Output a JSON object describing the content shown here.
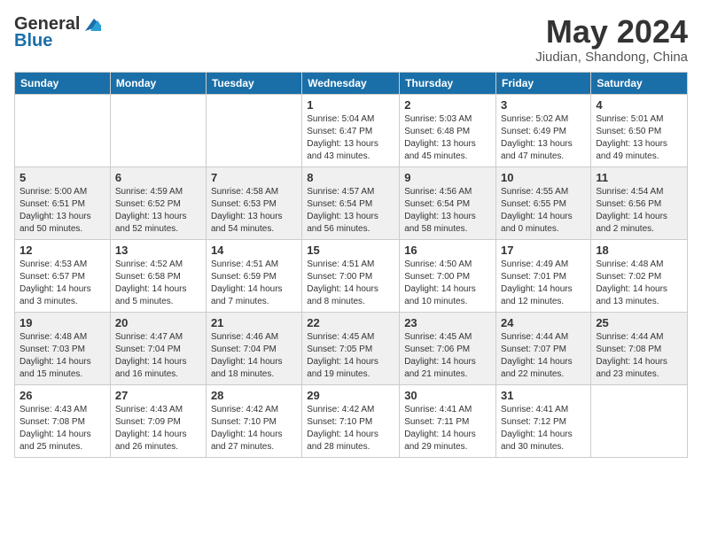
{
  "logo": {
    "general": "General",
    "blue": "Blue"
  },
  "title": "May 2024",
  "location": "Jiudian, Shandong, China",
  "weekdays": [
    "Sunday",
    "Monday",
    "Tuesday",
    "Wednesday",
    "Thursday",
    "Friday",
    "Saturday"
  ],
  "weeks": [
    [
      {
        "day": "",
        "info": ""
      },
      {
        "day": "",
        "info": ""
      },
      {
        "day": "",
        "info": ""
      },
      {
        "day": "1",
        "info": "Sunrise: 5:04 AM\nSunset: 6:47 PM\nDaylight: 13 hours\nand 43 minutes."
      },
      {
        "day": "2",
        "info": "Sunrise: 5:03 AM\nSunset: 6:48 PM\nDaylight: 13 hours\nand 45 minutes."
      },
      {
        "day": "3",
        "info": "Sunrise: 5:02 AM\nSunset: 6:49 PM\nDaylight: 13 hours\nand 47 minutes."
      },
      {
        "day": "4",
        "info": "Sunrise: 5:01 AM\nSunset: 6:50 PM\nDaylight: 13 hours\nand 49 minutes."
      }
    ],
    [
      {
        "day": "5",
        "info": "Sunrise: 5:00 AM\nSunset: 6:51 PM\nDaylight: 13 hours\nand 50 minutes."
      },
      {
        "day": "6",
        "info": "Sunrise: 4:59 AM\nSunset: 6:52 PM\nDaylight: 13 hours\nand 52 minutes."
      },
      {
        "day": "7",
        "info": "Sunrise: 4:58 AM\nSunset: 6:53 PM\nDaylight: 13 hours\nand 54 minutes."
      },
      {
        "day": "8",
        "info": "Sunrise: 4:57 AM\nSunset: 6:54 PM\nDaylight: 13 hours\nand 56 minutes."
      },
      {
        "day": "9",
        "info": "Sunrise: 4:56 AM\nSunset: 6:54 PM\nDaylight: 13 hours\nand 58 minutes."
      },
      {
        "day": "10",
        "info": "Sunrise: 4:55 AM\nSunset: 6:55 PM\nDaylight: 14 hours\nand 0 minutes."
      },
      {
        "day": "11",
        "info": "Sunrise: 4:54 AM\nSunset: 6:56 PM\nDaylight: 14 hours\nand 2 minutes."
      }
    ],
    [
      {
        "day": "12",
        "info": "Sunrise: 4:53 AM\nSunset: 6:57 PM\nDaylight: 14 hours\nand 3 minutes."
      },
      {
        "day": "13",
        "info": "Sunrise: 4:52 AM\nSunset: 6:58 PM\nDaylight: 14 hours\nand 5 minutes."
      },
      {
        "day": "14",
        "info": "Sunrise: 4:51 AM\nSunset: 6:59 PM\nDaylight: 14 hours\nand 7 minutes."
      },
      {
        "day": "15",
        "info": "Sunrise: 4:51 AM\nSunset: 7:00 PM\nDaylight: 14 hours\nand 8 minutes."
      },
      {
        "day": "16",
        "info": "Sunrise: 4:50 AM\nSunset: 7:00 PM\nDaylight: 14 hours\nand 10 minutes."
      },
      {
        "day": "17",
        "info": "Sunrise: 4:49 AM\nSunset: 7:01 PM\nDaylight: 14 hours\nand 12 minutes."
      },
      {
        "day": "18",
        "info": "Sunrise: 4:48 AM\nSunset: 7:02 PM\nDaylight: 14 hours\nand 13 minutes."
      }
    ],
    [
      {
        "day": "19",
        "info": "Sunrise: 4:48 AM\nSunset: 7:03 PM\nDaylight: 14 hours\nand 15 minutes."
      },
      {
        "day": "20",
        "info": "Sunrise: 4:47 AM\nSunset: 7:04 PM\nDaylight: 14 hours\nand 16 minutes."
      },
      {
        "day": "21",
        "info": "Sunrise: 4:46 AM\nSunset: 7:04 PM\nDaylight: 14 hours\nand 18 minutes."
      },
      {
        "day": "22",
        "info": "Sunrise: 4:45 AM\nSunset: 7:05 PM\nDaylight: 14 hours\nand 19 minutes."
      },
      {
        "day": "23",
        "info": "Sunrise: 4:45 AM\nSunset: 7:06 PM\nDaylight: 14 hours\nand 21 minutes."
      },
      {
        "day": "24",
        "info": "Sunrise: 4:44 AM\nSunset: 7:07 PM\nDaylight: 14 hours\nand 22 minutes."
      },
      {
        "day": "25",
        "info": "Sunrise: 4:44 AM\nSunset: 7:08 PM\nDaylight: 14 hours\nand 23 minutes."
      }
    ],
    [
      {
        "day": "26",
        "info": "Sunrise: 4:43 AM\nSunset: 7:08 PM\nDaylight: 14 hours\nand 25 minutes."
      },
      {
        "day": "27",
        "info": "Sunrise: 4:43 AM\nSunset: 7:09 PM\nDaylight: 14 hours\nand 26 minutes."
      },
      {
        "day": "28",
        "info": "Sunrise: 4:42 AM\nSunset: 7:10 PM\nDaylight: 14 hours\nand 27 minutes."
      },
      {
        "day": "29",
        "info": "Sunrise: 4:42 AM\nSunset: 7:10 PM\nDaylight: 14 hours\nand 28 minutes."
      },
      {
        "day": "30",
        "info": "Sunrise: 4:41 AM\nSunset: 7:11 PM\nDaylight: 14 hours\nand 29 minutes."
      },
      {
        "day": "31",
        "info": "Sunrise: 4:41 AM\nSunset: 7:12 PM\nDaylight: 14 hours\nand 30 minutes."
      },
      {
        "day": "",
        "info": ""
      }
    ]
  ]
}
